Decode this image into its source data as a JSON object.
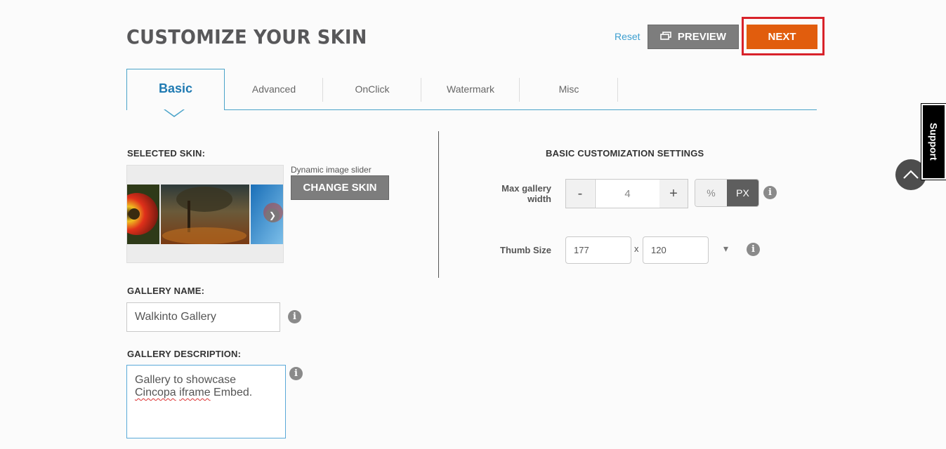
{
  "header": {
    "title": "CUSTOMIZE YOUR SKIN",
    "reset_label": "Reset",
    "preview_label": "PREVIEW",
    "next_label": "NEXT"
  },
  "tabs": [
    {
      "label": "Basic",
      "active": true
    },
    {
      "label": "Advanced",
      "active": false
    },
    {
      "label": "OnClick",
      "active": false
    },
    {
      "label": "Watermark",
      "active": false
    },
    {
      "label": "Misc",
      "active": false
    }
  ],
  "left": {
    "selected_skin_label": "SELECTED SKIN:",
    "skin_name": "Dynamic image slider",
    "change_skin_label": "CHANGE SKIN",
    "gallery_name_label": "GALLERY NAME:",
    "gallery_name_value": "Walkinto Gallery",
    "gallery_description_label": "GALLERY DESCRIPTION:",
    "gallery_description_line1": "Gallery to showcase",
    "gallery_description_word1": "Cincopa",
    "gallery_description_word2": "iframe",
    "gallery_description_rest": " Embed."
  },
  "right": {
    "heading": "BASIC CUSTOMIZATION SETTINGS",
    "max_width_label_line1": "Max gallery",
    "max_width_label_line2": "width",
    "stepper_minus": "-",
    "stepper_plus": "+",
    "max_width_value": "4",
    "unit_options": [
      "%",
      "PX"
    ],
    "unit_selected": "PX",
    "thumb_size_label": "Thumb Size",
    "thumb_width": "177",
    "thumb_separator": "x",
    "thumb_height": "120",
    "dropdown_arrow": "▾"
  },
  "side": {
    "support_label": "Support"
  },
  "colors": {
    "accent": "#e15d0d",
    "highlight": "#d8222a",
    "tab_active": "#1f7ab2",
    "link": "#3d9fd0"
  }
}
